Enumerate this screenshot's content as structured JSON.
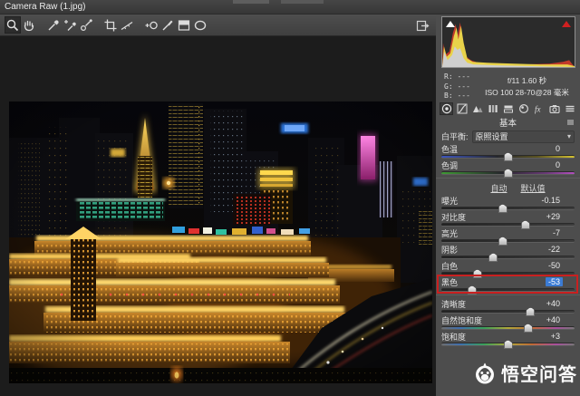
{
  "window": {
    "title": "Camera Raw (1.jpg)"
  },
  "toolbar": {
    "tools": [
      "zoom",
      "hand",
      "white-balance",
      "color-sampler",
      "targeted-adjustment",
      "crop",
      "straighten",
      "red-eye",
      "adjustment-brush",
      "graduated-filter",
      "radial-filter"
    ],
    "active_tool": "zoom",
    "fullscreen_toggle": "toggle-fullscreen"
  },
  "histogram": {
    "rgb_readout": [
      "R: ---",
      "G: ---",
      "B: ---"
    ],
    "exif_line1": "f/11  1.60 秒",
    "exif_line2": "ISO 100  28-70@28 毫米",
    "shadow_clip_color": "#ffffff",
    "highlight_clip_color": "#d02020"
  },
  "panel": {
    "tabs": [
      "basic",
      "tone-curve",
      "detail",
      "hsl-grayscale",
      "split-toning",
      "lens-corrections",
      "effects",
      "camera-calibration",
      "presets"
    ],
    "active_tab": "basic",
    "section_title": "基本",
    "white_balance_label": "白平衡:",
    "white_balance_value": "原照设置",
    "auto_link": "自动",
    "default_link": "默认值",
    "sliders": [
      {
        "id": "temperature",
        "label": "色温",
        "value": "0",
        "pos": 50
      },
      {
        "id": "tint",
        "label": "色调",
        "value": "0",
        "pos": 50
      },
      {
        "id": "exposure",
        "label": "曝光",
        "value": "-0.15",
        "pos": 46
      },
      {
        "id": "contrast",
        "label": "对比度",
        "value": "+29",
        "pos": 63
      },
      {
        "id": "highlights",
        "label": "高光",
        "value": "-7",
        "pos": 46
      },
      {
        "id": "shadows",
        "label": "阴影",
        "value": "-22",
        "pos": 39
      },
      {
        "id": "whites",
        "label": "白色",
        "value": "-50",
        "pos": 27
      },
      {
        "id": "blacks",
        "label": "黑色",
        "value": "-53",
        "pos": 23,
        "selected": true,
        "highlighted": true
      },
      {
        "id": "clarity",
        "label": "清晰度",
        "value": "+40",
        "pos": 67
      },
      {
        "id": "vibrance",
        "label": "自然饱和度",
        "value": "+40",
        "pos": 65
      },
      {
        "id": "saturation",
        "label": "饱和度",
        "value": "+3",
        "pos": 50
      }
    ]
  },
  "icons": {
    "chevron_down": "▾",
    "effects_glyph": "fx"
  },
  "watermark": {
    "text": "悟空问答"
  },
  "colors": {
    "panel_bg": "#4d4d4d",
    "preview_bg": "#1c1c1c",
    "selection_blue": "#3b7bd4",
    "highlight_box_red": "#c92020"
  }
}
